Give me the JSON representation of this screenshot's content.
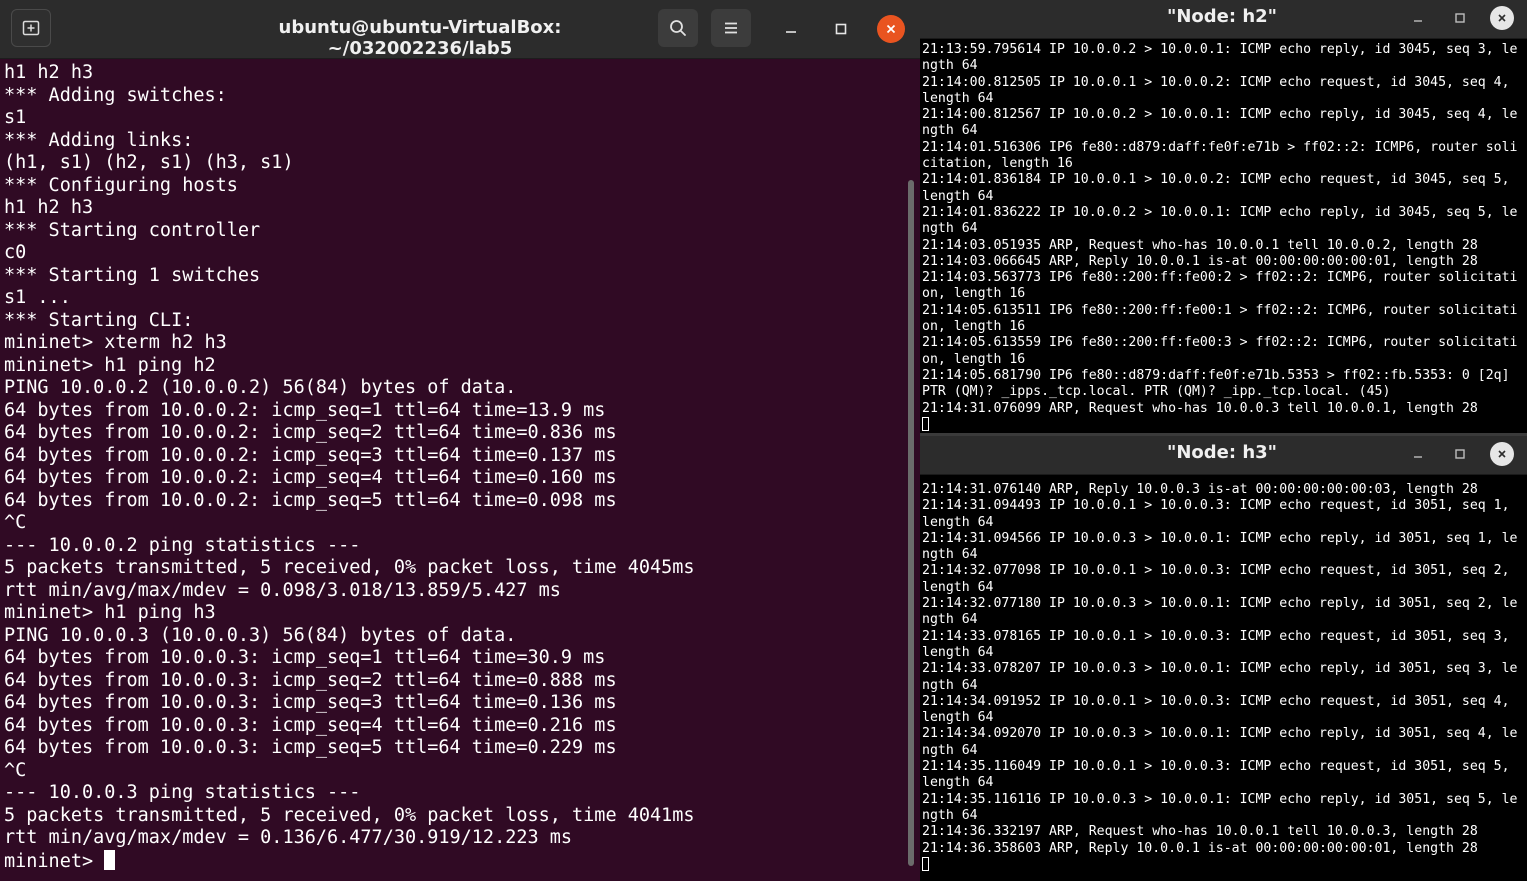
{
  "main_window": {
    "title": "ubuntu@ubuntu-VirtualBox: ~/032002236/lab5",
    "prompt": "mininet> ",
    "lines": [
      "h1 h2 h3",
      "*** Adding switches:",
      "s1",
      "*** Adding links:",
      "(h1, s1) (h2, s1) (h3, s1)",
      "*** Configuring hosts",
      "h1 h2 h3",
      "*** Starting controller",
      "c0",
      "*** Starting 1 switches",
      "s1 ...",
      "*** Starting CLI:",
      "mininet> xterm h2 h3",
      "mininet> h1 ping h2",
      "PING 10.0.0.2 (10.0.0.2) 56(84) bytes of data.",
      "64 bytes from 10.0.0.2: icmp_seq=1 ttl=64 time=13.9 ms",
      "64 bytes from 10.0.0.2: icmp_seq=2 ttl=64 time=0.836 ms",
      "64 bytes from 10.0.0.2: icmp_seq=3 ttl=64 time=0.137 ms",
      "64 bytes from 10.0.0.2: icmp_seq=4 ttl=64 time=0.160 ms",
      "64 bytes from 10.0.0.2: icmp_seq=5 ttl=64 time=0.098 ms",
      "^C",
      "--- 10.0.0.2 ping statistics ---",
      "5 packets transmitted, 5 received, 0% packet loss, time 4045ms",
      "rtt min/avg/max/mdev = 0.098/3.018/13.859/5.427 ms",
      "mininet> h1 ping h3",
      "PING 10.0.0.3 (10.0.0.3) 56(84) bytes of data.",
      "64 bytes from 10.0.0.3: icmp_seq=1 ttl=64 time=30.9 ms",
      "64 bytes from 10.0.0.3: icmp_seq=2 ttl=64 time=0.888 ms",
      "64 bytes from 10.0.0.3: icmp_seq=3 ttl=64 time=0.136 ms",
      "64 bytes from 10.0.0.3: icmp_seq=4 ttl=64 time=0.216 ms",
      "64 bytes from 10.0.0.3: icmp_seq=5 ttl=64 time=0.229 ms",
      "^C",
      "--- 10.0.0.3 ping statistics ---",
      "5 packets transmitted, 5 received, 0% packet loss, time 4041ms",
      "rtt min/avg/max/mdev = 0.136/6.477/30.919/12.223 ms"
    ],
    "colors": {
      "background": "#300a24",
      "close_button": "#e95420"
    }
  },
  "xterm_h2": {
    "title": "\"Node: h2\"",
    "lines": [
      "21:13:59.795614 IP 10.0.0.2 > 10.0.0.1: ICMP echo reply, id 3045, seq 3, length 64",
      "21:14:00.812505 IP 10.0.0.1 > 10.0.0.2: ICMP echo request, id 3045, seq 4, length 64",
      "21:14:00.812567 IP 10.0.0.2 > 10.0.0.1: ICMP echo reply, id 3045, seq 4, length 64",
      "21:14:01.516306 IP6 fe80::d879:daff:fe0f:e71b > ff02::2: ICMP6, router solicitation, length 16",
      "21:14:01.836184 IP 10.0.0.1 > 10.0.0.2: ICMP echo request, id 3045, seq 5, length 64",
      "21:14:01.836222 IP 10.0.0.2 > 10.0.0.1: ICMP echo reply, id 3045, seq 5, length 64",
      "21:14:03.051935 ARP, Request who-has 10.0.0.1 tell 10.0.0.2, length 28",
      "21:14:03.066645 ARP, Reply 10.0.0.1 is-at 00:00:00:00:00:01, length 28",
      "21:14:03.563773 IP6 fe80::200:ff:fe00:2 > ff02::2: ICMP6, router solicitation, length 16",
      "21:14:05.613511 IP6 fe80::200:ff:fe00:1 > ff02::2: ICMP6, router solicitation, length 16",
      "21:14:05.613559 IP6 fe80::200:ff:fe00:3 > ff02::2: ICMP6, router solicitation, length 16",
      "21:14:05.681790 IP6 fe80::d879:daff:fe0f:e71b.5353 > ff02::fb.5353: 0 [2q] PTR (QM)? _ipps._tcp.local. PTR (QM)? _ipp._tcp.local. (45)",
      "21:14:31.076099 ARP, Request who-has 10.0.0.3 tell 10.0.0.1, length 28"
    ]
  },
  "xterm_h3": {
    "title": "\"Node: h3\"",
    "lines": [
      "21:14:31.076140 ARP, Reply 10.0.0.3 is-at 00:00:00:00:00:03, length 28",
      "21:14:31.094493 IP 10.0.0.1 > 10.0.0.3: ICMP echo request, id 3051, seq 1, length 64",
      "21:14:31.094566 IP 10.0.0.3 > 10.0.0.1: ICMP echo reply, id 3051, seq 1, length 64",
      "21:14:32.077098 IP 10.0.0.1 > 10.0.0.3: ICMP echo request, id 3051, seq 2, length 64",
      "21:14:32.077180 IP 10.0.0.3 > 10.0.0.1: ICMP echo reply, id 3051, seq 2, length 64",
      "21:14:33.078165 IP 10.0.0.1 > 10.0.0.3: ICMP echo request, id 3051, seq 3, length 64",
      "21:14:33.078207 IP 10.0.0.3 > 10.0.0.1: ICMP echo reply, id 3051, seq 3, length 64",
      "21:14:34.091952 IP 10.0.0.1 > 10.0.0.3: ICMP echo request, id 3051, seq 4, length 64",
      "21:14:34.092070 IP 10.0.0.3 > 10.0.0.1: ICMP echo reply, id 3051, seq 4, length 64",
      "21:14:35.116049 IP 10.0.0.1 > 10.0.0.3: ICMP echo request, id 3051, seq 5, length 64",
      "21:14:35.116116 IP 10.0.0.3 > 10.0.0.1: ICMP echo reply, id 3051, seq 5, length 64",
      "21:14:36.332197 ARP, Request who-has 10.0.0.1 tell 10.0.0.3, length 28",
      "21:14:36.358603 ARP, Reply 10.0.0.1 is-at 00:00:00:00:00:01, length 28"
    ]
  },
  "icons": {
    "new_tab": "new-tab-icon",
    "search": "search-icon",
    "menu": "hamburger-menu-icon",
    "minimize": "minimize-icon",
    "maximize": "maximize-icon",
    "close": "close-icon"
  }
}
